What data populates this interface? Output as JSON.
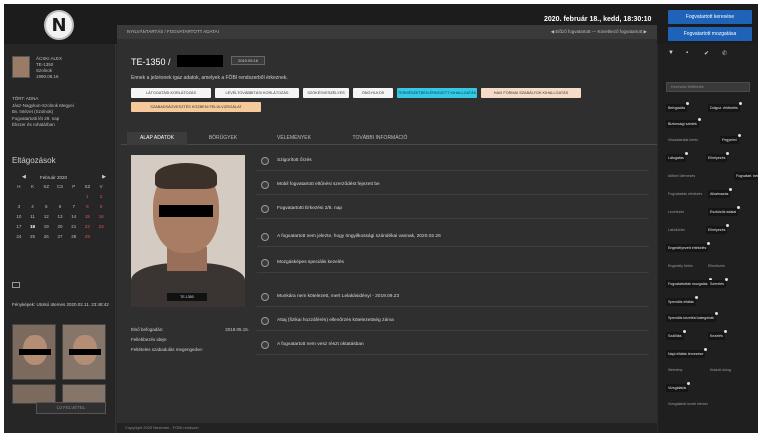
{
  "topbar": {
    "logo_letter": "N",
    "datetime": "2020. február 18., kedd, 18:30:10",
    "buttons": [
      "Fogvatartott keresése",
      "Fogvatartott mozgatása"
    ]
  },
  "left": {
    "user_info": [
      "ÁCSKI ALEX",
      "TE-1350",
      "Szolnok",
      "1990.08.16"
    ],
    "user_meta": [
      "TÖRT: ADNA",
      "Jász-Nagykun-Szolnok Megyei",
      "Bv. Intézet (Szolnok)",
      "Fogvatartotti lét 29. nap",
      "Ékszer és ruhatárban"
    ],
    "calendar_title": "Eltágozások",
    "calendar_month": "Február 2020",
    "calendar_prev": "◀",
    "calendar_next": "▶",
    "calendar_days": [
      "H",
      "K",
      "SZ",
      "CS",
      "P",
      "SZ",
      "V",
      "",
      "",
      "",
      "",
      "",
      "1",
      "2",
      "3",
      "4",
      "5",
      "6",
      "7",
      "8",
      "9",
      "10",
      "11",
      "12",
      "13",
      "14",
      "15",
      "16",
      "17",
      "18",
      "19",
      "20",
      "21",
      "22",
      "23",
      "24",
      "25",
      "26",
      "27",
      "28",
      "29",
      ""
    ],
    "mugshots_title": "Fényképek: Utolsó ütemes 2020.02.11. 23:48:42",
    "button": "ÚJ FELVÉTEL"
  },
  "main": {
    "header_crumb": "NYILVÁNTARTÁS / FOGVATARTOTT ADATAI",
    "header_nav": "◀ Előző fogvatartott — Következő fogvatartott ▶",
    "case_id": "TE-1350 /",
    "case_chip": "2019.09.16",
    "case_desc": "Ennek a jelzésnek igaz adatok, amelyek a FÖBI rendszerből érkeznek.",
    "tags": [
      "LÁTOGATÁSI KORLÁTOZÁS",
      "LÉVÉLTOVÁBBÍTÁSI KORLÁTOZÁS",
      "SZÖKÉSVESZÉLYES",
      "ÖNGYILKOS",
      "TERMÉSZETBEN ÉRKEZETT KIHALLGATÁS",
      "HAVI FORMAI SZABÁLYOK KIHALLGATÁS",
      "SZABADSÁGVESZTÉS KÖZBENI FELÜLVIZSGÁLAT"
    ],
    "tabs": [
      "ALAP ADATOK",
      "BŐRÜGYEK",
      "VÉLEMÉNYEK",
      "TOVÁBBI INFORMÁCIÓ"
    ],
    "photo_plate": "TE-1350",
    "details": [
      {
        "label": "Első befogadás:",
        "value": "2018.05.15."
      },
      {
        "label": "Fellebbezés ideje:",
        "value": ""
      },
      {
        "label": "Feltételes szabadulás megengedve:",
        "value": ""
      }
    ],
    "events": [
      "Szigorított őrzés",
      "Mobil fogvatartott eltűnési szerződést fejezett be",
      "Fogvatartotti Érkezési 2/8. nap",
      "A fogvatartott nem jelezte, hogy öngyilkossági szándékai vannak, 2020.02.26",
      "Mozgásképes speciális kezelés",
      "Munkára nem kötelezett, mert Lelakásidényi - 2019.09.23",
      "Attaj (fizikai hozzáférés) ellenőrzés kötelezettség zárva",
      "A fogvatartott nem vesz részt oktatásban"
    ],
    "footer": "Copyright 2020 Nexteam - FÖBI rendszer"
  },
  "right": {
    "icons": [
      "filter-icon",
      "save-icon",
      "check-icon",
      "phone-icon"
    ],
    "icon_glyphs": [
      "▼",
      "▪",
      "✔",
      "✆"
    ],
    "search_placeholder": "Keresési feltételek",
    "chips": [
      {
        "text": "Befogadás",
        "light": false
      },
      {
        "text": "Dolgoz. értékelés",
        "light": false
      },
      {
        "text": "Biztonsági szintek",
        "light": false
      },
      {
        "text": "Visszatartási kérés",
        "light": true
      },
      {
        "text": "Fegyelmi",
        "light": false
      },
      {
        "text": "Látogatás",
        "light": false
      },
      {
        "text": "Elhelyezés",
        "light": false
      },
      {
        "text": "Időbeli ütemezés",
        "light": true
      },
      {
        "text": "Fogvatart. bér",
        "light": false
      },
      {
        "text": "Fogvatartás elintézés",
        "light": true
      },
      {
        "text": "Alkalmazás",
        "light": false
      },
      {
        "text": "Levelezés",
        "light": true
      },
      {
        "text": "Eszközök adatai",
        "light": false
      },
      {
        "text": "Lakókörlet",
        "light": true
      },
      {
        "text": "Elhelyezés",
        "light": false
      },
      {
        "text": "Engedélyezett értékelés",
        "light": false
      },
      {
        "text": "Engedély törlés",
        "light": true
      },
      {
        "text": "Ellenőrzés",
        "light": true
      },
      {
        "text": "Fogvatartottak mozgatás",
        "light": false
      },
      {
        "text": "Szerelés",
        "light": false
      },
      {
        "text": "Speciális ellátás",
        "light": false
      },
      {
        "text": "Speciális kezelési kategóriák",
        "light": false
      },
      {
        "text": "Szállítás",
        "light": false
      },
      {
        "text": "Kezelés",
        "light": false
      },
      {
        "text": "Napi ellátás tervezése",
        "light": false
      },
      {
        "text": "Illetmény",
        "light": true
      },
      {
        "text": "Kiadott dolog",
        "light": true
      },
      {
        "text": "Vizsgálatok",
        "light": false
      },
      {
        "text": "Vizsgálatok lezárt elemei",
        "light": true
      }
    ]
  }
}
